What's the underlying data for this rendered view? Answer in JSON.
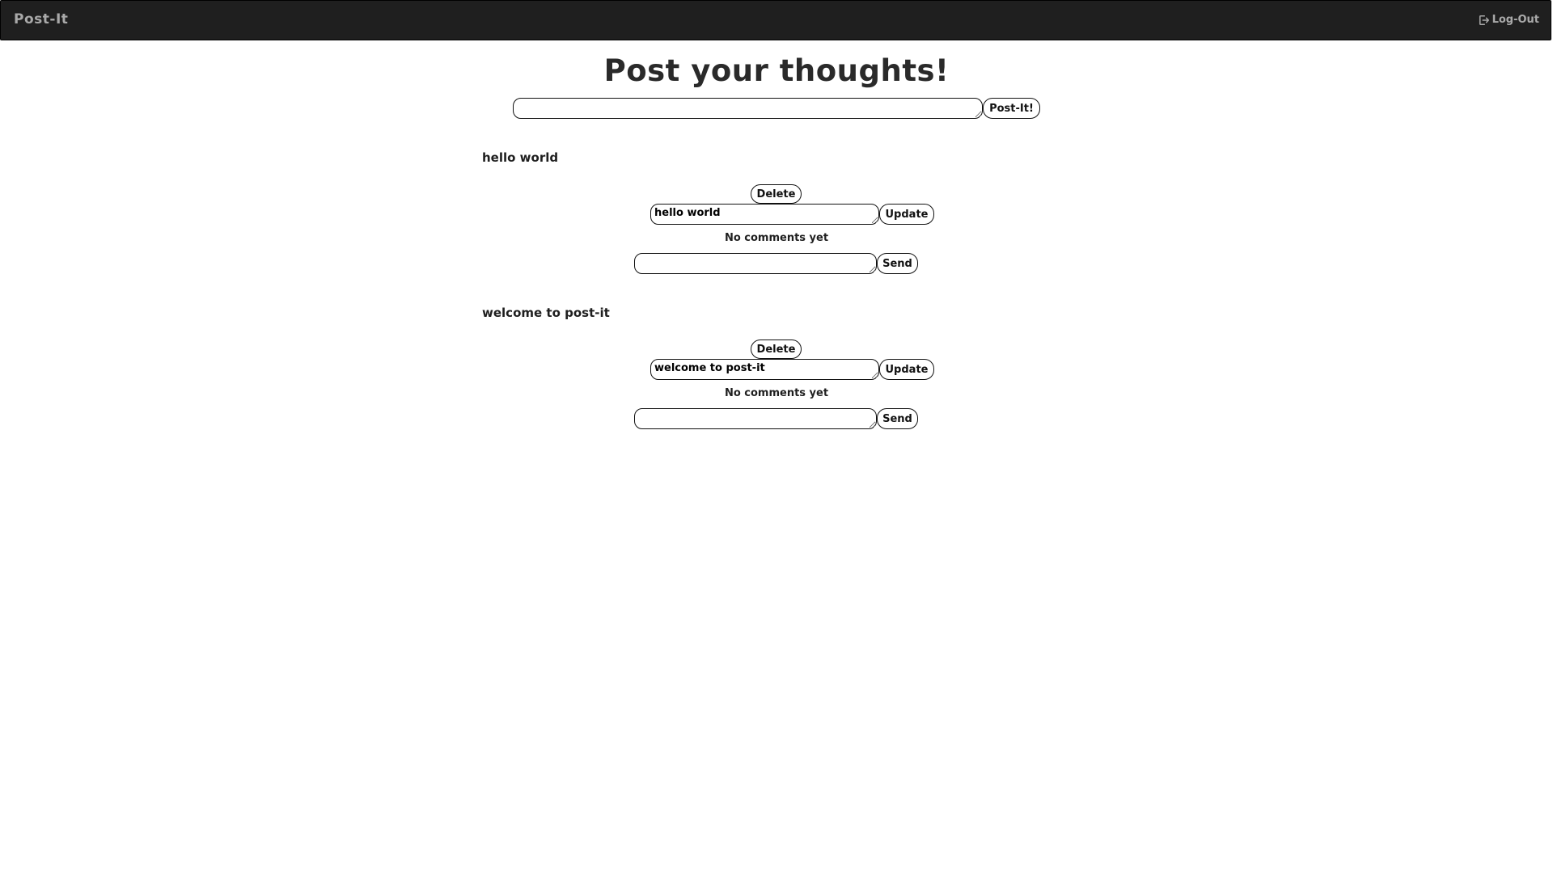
{
  "header": {
    "brand": "Post-It",
    "logout_label": "Log-Out"
  },
  "composer": {
    "title": "Post your thoughts!",
    "input_value": "",
    "submit_label": "Post-It!"
  },
  "posts": [
    {
      "text": "hello world",
      "delete_label": "Delete",
      "edit_value": "hello world",
      "update_label": "Update",
      "comments_status": "No comments yet",
      "comment_value": "",
      "send_label": "Send"
    },
    {
      "text": "welcome to post-it",
      "delete_label": "Delete",
      "edit_value": "welcome to post-it",
      "update_label": "Update",
      "comments_status": "No comments yet",
      "comment_value": "",
      "send_label": "Send"
    }
  ],
  "colors": {
    "navbar_bg": "#1f1f1f",
    "navbar_text": "#a9a9a9",
    "page_bg": "#ffffff"
  }
}
